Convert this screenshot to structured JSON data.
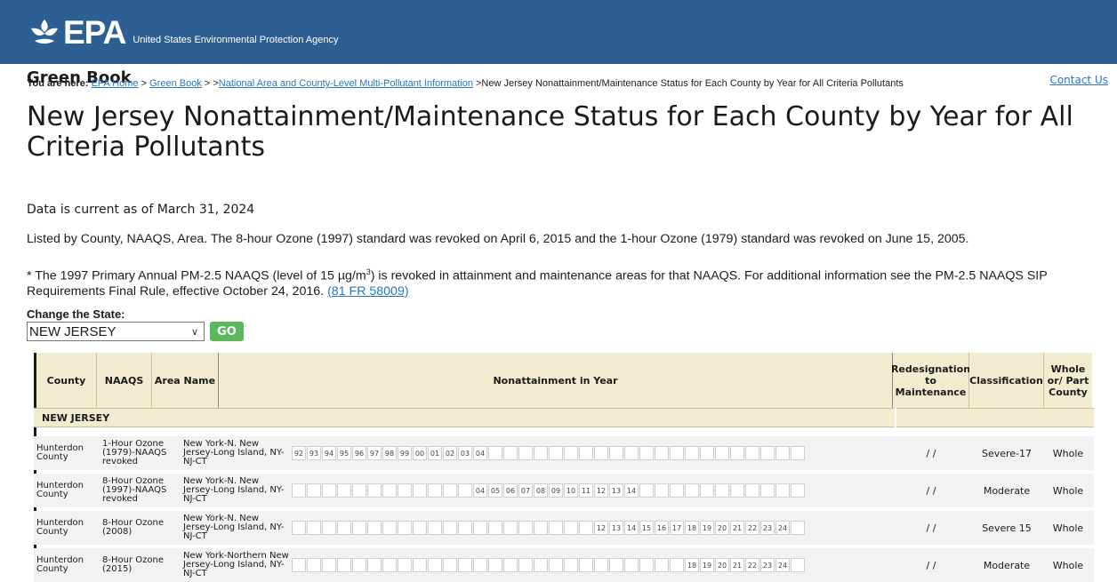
{
  "header": {
    "logo_text": "EPA",
    "agency": "United States Environmental Protection Agency"
  },
  "site": {
    "name": "Green Book",
    "contact": "Contact Us"
  },
  "breadcrumb": {
    "prefix": "You are here:",
    "items": [
      "EPA Home",
      "Green Book",
      "National Area and County-Level Multi-Pollutant Information"
    ],
    "current": "New Jersey Nonattainment/Maintenance Status for Each County by Year for All Criteria Pollutants"
  },
  "title": "New Jersey Nonattainment/Maintenance Status for Each County by Year for All Criteria Pollutants",
  "current_as_of": "Data is current as of March 31, 2024",
  "para1": "Listed by County, NAAQS, Area. The 8-hour Ozone (1997) standard was revoked on April 6, 2015 and the 1-hour Ozone (1979) standard was revoked on June 15, 2005.",
  "para2_a": "* The 1997 Primary Annual PM-2.5 NAAQS (level of 15 µg/m",
  "para2_sup": "3",
  "para2_b": ") is revoked in attainment and maintenance areas for that NAAQS. For additional information see the PM-2.5 NAAQS SIP Requirements Final Rule, effective October 24, 2016.",
  "para2_link": "(81 FR 58009)",
  "state_form": {
    "label": "Change the State:",
    "selected": "NEW JERSEY",
    "go": "GO"
  },
  "table": {
    "headers": {
      "county": "County",
      "naaqs": "NAAQS",
      "area": "Area Name",
      "years": "Nonattainment in Year",
      "redesignation": "Redesignation to Maintenance",
      "classification": "Classification",
      "whole": "Whole or/ Part County"
    },
    "state": "NEW JERSEY",
    "rows": [
      {
        "county": "Hunterdon County",
        "naaqs": "1-Hour Ozone (1979)-NAAQS revoked",
        "area": "New York-N. New Jersey-Long Island, NY-NJ-CT",
        "years": [
          "92",
          "93",
          "94",
          "95",
          "96",
          "97",
          "98",
          "99",
          "00",
          "01",
          "02",
          "03",
          "04",
          "",
          "",
          "",
          "",
          "",
          "",
          "",
          "",
          "",
          "",
          "",
          "",
          "",
          "",
          "",
          "",
          "",
          "",
          "",
          "",
          ""
        ],
        "redesignation": "/ /",
        "classification": "Severe-17",
        "whole": "Whole"
      },
      {
        "county": "Hunterdon County",
        "naaqs": "8-Hour Ozone (1997)-NAAQS revoked",
        "area": "New York-N. New Jersey-Long Island, NY-NJ-CT",
        "years": [
          "",
          "",
          "",
          "",
          "",
          "",
          "",
          "",
          "",
          "",
          "",
          "",
          "04",
          "05",
          "06",
          "07",
          "08",
          "09",
          "10",
          "11",
          "12",
          "13",
          "14",
          "",
          "",
          "",
          "",
          "",
          "",
          "",
          "",
          "",
          "",
          ""
        ],
        "redesignation": "/ /",
        "classification": "Moderate",
        "whole": "Whole"
      },
      {
        "county": "Hunterdon County",
        "naaqs": "8-Hour Ozone (2008)",
        "area": "New York-N. New Jersey-Long Island, NY-NJ-CT",
        "years": [
          "",
          "",
          "",
          "",
          "",
          "",
          "",
          "",
          "",
          "",
          "",
          "",
          "",
          "",
          "",
          "",
          "",
          "",
          "",
          "",
          "12",
          "13",
          "14",
          "15",
          "16",
          "17",
          "18",
          "19",
          "20",
          "21",
          "22",
          "23",
          "24",
          ""
        ],
        "redesignation": "/ /",
        "classification": "Severe 15",
        "whole": "Whole"
      },
      {
        "county": "Hunterdon County",
        "naaqs": "8-Hour Ozone (2015)",
        "area": "New York-Northern New Jersey-Long Island, NY-NJ-CT",
        "years": [
          "",
          "",
          "",
          "",
          "",
          "",
          "",
          "",
          "",
          "",
          "",
          "",
          "",
          "",
          "",
          "",
          "",
          "",
          "",
          "",
          "",
          "",
          "",
          "",
          "",
          "",
          "18",
          "19",
          "20",
          "21",
          "22",
          "23",
          "24",
          ""
        ],
        "redesignation": "/ /",
        "classification": "Moderate",
        "whole": "Whole"
      }
    ]
  },
  "colors": {
    "banner": "#2d5f93",
    "header_bg": "#f1ecd0",
    "link": "#2378c3",
    "go_button": "#5cb85c"
  }
}
